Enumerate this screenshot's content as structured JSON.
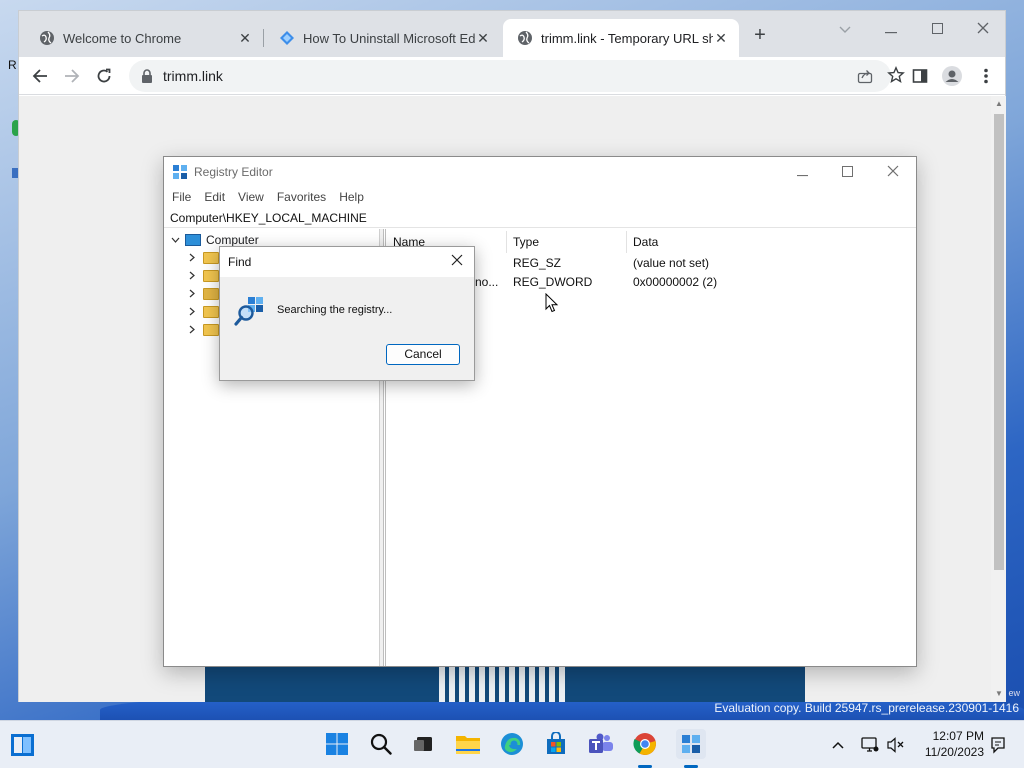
{
  "desktop": {
    "edge_letter": "R",
    "eval_text": "Evaluation copy. Build 25947.rs_prerelease.230901-1416",
    "edge_ew": "ew"
  },
  "chrome": {
    "tabs": [
      {
        "title": "Welcome to Chrome",
        "icon": "globe-icon"
      },
      {
        "title": "How To Uninstall Microsoft Edg",
        "icon": "diamond-icon"
      },
      {
        "title": "trimm.link - Temporary URL sho",
        "icon": "globe-icon",
        "active": true
      }
    ],
    "close_glyph": "✕",
    "newtab_glyph": "+",
    "url": "trimm.link"
  },
  "regedit": {
    "title": "Registry Editor",
    "menu": [
      "File",
      "Edit",
      "View",
      "Favorites",
      "Help"
    ],
    "address": "Computer\\HKEY_LOCAL_MACHINE",
    "tree_root": "Computer",
    "columns": {
      "name": "Name",
      "type": "Type",
      "data": "Data"
    },
    "rows": [
      {
        "name": "",
        "type": "REG_SZ",
        "data": "(value not set)"
      },
      {
        "name": "no...",
        "type": "REG_DWORD",
        "data": "0x00000002 (2)"
      }
    ]
  },
  "find": {
    "title": "Find",
    "message": "Searching the registry...",
    "cancel": "Cancel"
  },
  "taskbar": {
    "time": "12:07 PM",
    "date": "11/20/2023"
  },
  "colors": {
    "accent": "#0067c0",
    "chrome_tabstrip": "#dee1e6",
    "omnibox": "#f1f3f4"
  }
}
